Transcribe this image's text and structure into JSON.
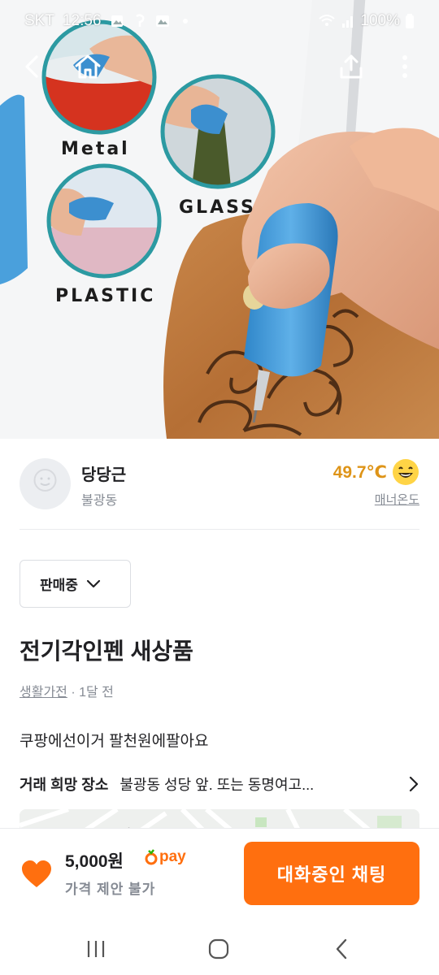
{
  "status_bar": {
    "carrier": "SKT",
    "time": "12:56",
    "battery": "100%",
    "icons": [
      "gallery-icon",
      "notification-icon",
      "photo-icon",
      "dot-icon",
      "wifi-icon",
      "signal-icon",
      "battery-icon"
    ]
  },
  "top_nav": {
    "icons": [
      "back-icon",
      "home-icon",
      "share-icon",
      "more-icon"
    ]
  },
  "hero_image": {
    "labels": {
      "metal": "Metal",
      "glass": "GLASS",
      "plastic": "PLASTIC"
    }
  },
  "seller": {
    "name": "당당근",
    "location": "불광동",
    "temperature": "49.7℃",
    "manner_label": "매너온도",
    "emoji_icon": "smiley-icon"
  },
  "status_select": {
    "value": "판매중"
  },
  "post": {
    "title": "전기각인펜 새상품",
    "category": "생활가전",
    "time_ago": " · 1달 전",
    "description": "쿠팡에선이거 팔천원에팔아요",
    "place_label": "거래 희망 장소",
    "place_value": "불광동 성당 앞.  또는 동명여고..."
  },
  "bottom_bar": {
    "price": "5,000원",
    "pay_label": "pay",
    "negotiation": "가격 제안 불가",
    "chat_button": "대화중인 채팅",
    "accent_color": "#ff6f0f"
  },
  "nav_bar": {
    "icons": [
      "recent-apps-icon",
      "home-button-icon",
      "back-button-icon"
    ]
  }
}
